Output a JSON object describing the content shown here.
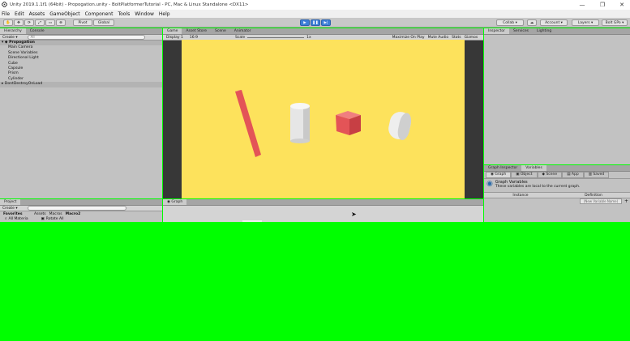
{
  "window": {
    "title": "Unity 2019.1.1f1 (64bit) - Propogation.unity - BoltPlatformerTutorial - PC, Mac & Linux Standalone <DX11>",
    "controls": [
      "—",
      "❐",
      "✕"
    ]
  },
  "menu": [
    "File",
    "Edit",
    "Assets",
    "GameObject",
    "Component",
    "Tools",
    "Window",
    "Help"
  ],
  "toolbar": {
    "pivot_label": "Pivot",
    "global_label": "Global",
    "collab_label": "Collab ▾",
    "account_label": "Account ▾",
    "layers_label": "Layers ▾",
    "layout_label": "Bolt GPo ▾"
  },
  "hierarchy": {
    "tabs": [
      "Hierarchy",
      "Console"
    ],
    "create_label": "Create ▾",
    "search_placeholder": "All",
    "scene": "Propogation",
    "items": [
      "Main Camera",
      "Scene Variables",
      "Directional Light",
      "Cube",
      "Capsule",
      "Prism",
      "Cylinder"
    ],
    "dont_destroy": "DontDestroyOnLoad"
  },
  "project": {
    "tabs": [
      "Project"
    ],
    "create_label": "Create ▾",
    "favorites_label": "Favorites",
    "favorites_item": "All Materia",
    "breadcrumb": [
      "Assets",
      "Macros",
      "Macro2"
    ],
    "file_item": "Rotate All"
  },
  "game": {
    "tabs": [
      "Game",
      "Asset Store",
      "Scene",
      "Animator"
    ],
    "display_label": "Display 1",
    "aspect_label": "16:9",
    "scale_label": "Scale",
    "scale_value": "1x",
    "options": [
      "Maximize On Play",
      "Mute Audio",
      "Stats",
      "Gizmos"
    ]
  },
  "graph": {
    "tab": "Graph"
  },
  "inspector": {
    "tabs": [
      "Inspector",
      "Services",
      "Lighting"
    ]
  },
  "variables": {
    "tabs": [
      "Graph Inspector",
      "Variables"
    ],
    "kinds": [
      "Graph",
      "Object",
      "Scene",
      "App",
      "Saved"
    ],
    "heading": "Graph Variables",
    "description": "These variables are local to the current graph.",
    "columns": [
      "Instance",
      "Definition"
    ],
    "new_placeholder": "(New Variable Name)"
  },
  "colors": {
    "game_background": "#fde25c",
    "object_red": "#e35457",
    "play_blue": "#3d7fd8",
    "empty_area": "#00ff00"
  }
}
